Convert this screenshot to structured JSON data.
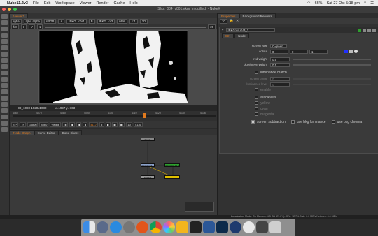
{
  "menubar": {
    "app_name": "Nuke11.2v3",
    "items": [
      "File",
      "Edit",
      "Workspace",
      "Viewer",
      "Render",
      "Cache",
      "Help"
    ],
    "battery": "66%",
    "datetime": "Sat 27 Oct  5:18 pm"
  },
  "window": {
    "title": "Shot_004_v001.nknc [modified] - NukeX"
  },
  "viewer": {
    "tab": "Viewer1",
    "controls": {
      "layer": "rgba",
      "channel": "rgba.alpha",
      "colorspace": "sRGB",
      "input_a": "A",
      "input_a_node": "IBKG...olV1",
      "input_b": "B",
      "input_b_node": "IBKG...ol3",
      "zoom": "66%",
      "ratio": "1:1",
      "mode": "2D"
    },
    "gain_label": "f/8",
    "gain_value": "1",
    "gamma_label": "Y",
    "gamma_value": "1",
    "frame_field": "20",
    "format_info": "HD_1080 1920x1080",
    "coords": "x=1997 y=763"
  },
  "timeline": {
    "ticks": [
      "4060",
      "4070",
      "4080",
      "4090",
      "4100",
      "4110",
      "4120",
      "4130",
      "4136"
    ],
    "current_frame": "4117",
    "fps": "24*",
    "tc": "TF",
    "mode": "Global",
    "playback": "Visible",
    "step": "10",
    "end_frame": "4136",
    "in_frame": "4060"
  },
  "nodegraph": {
    "tabs": [
      "Node Graph",
      "Curve Editor",
      "Dope Sheet"
    ],
    "nodes": [
      "Read1",
      "IBKGizmoV3_1",
      "IBKColourV3_1",
      "Viewer1"
    ]
  },
  "properties": {
    "tabs": [
      "Properties",
      "Background Renders"
    ],
    "panel_count": "10",
    "node_name": "IBKColourV3_1",
    "subtabs": [
      "IBK",
      "Node"
    ],
    "screen_type_label": "screen type",
    "screen_type_value": "C-green",
    "colour_label": "colour",
    "colour_values": [
      "0",
      "0",
      "1"
    ],
    "red_weight_label": "red weight",
    "red_weight_value": "0.5",
    "bluegreen_weight_label": "blue/green weight",
    "bluegreen_weight_value": "0.5",
    "luminance_match_label": "luminance match",
    "screen_range_label": "screen range",
    "screen_range_value": "0",
    "luminance_level_label": "luminance level",
    "luminance_level_value": "0",
    "enable_label": "enable",
    "autolevels_label": "autolevels",
    "yellow_label": "yellow",
    "cyan_label": "cyan",
    "magenta_label": "magenta",
    "screen_subtraction_label": "screen subtraction",
    "use_bkg_luminance_label": "use bkg luminance",
    "use_bkg_chroma_label": "use bkg chroma"
  },
  "statusbar": {
    "text": "Localization Mode: On  Memory: 4.3 GB (27.0%)  CPU: 12.7%  Disk: 0.0 MB/s  Network: 0.0 MB/s"
  },
  "dock": {
    "apps": [
      "finder",
      "launchpad",
      "safari",
      "system-preferences",
      "firefox",
      "chrome",
      "photos",
      "nuke",
      "final-cut",
      "word",
      "photoshop",
      "quicktime",
      "itunes",
      "preview",
      "trash"
    ]
  }
}
